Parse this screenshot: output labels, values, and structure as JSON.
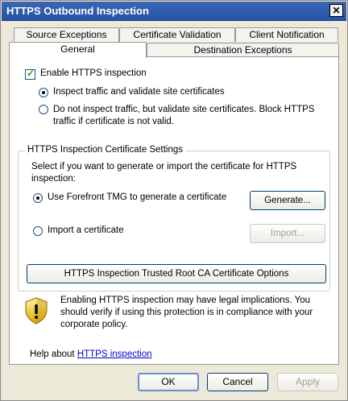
{
  "window": {
    "title": "HTTPS Outbound Inspection",
    "close_glyph": "✕"
  },
  "tabs": [
    {
      "label": "Source Exceptions"
    },
    {
      "label": "Certificate Validation"
    },
    {
      "label": "Client Notification"
    },
    {
      "label": "General"
    },
    {
      "label": "Destination Exceptions"
    }
  ],
  "general": {
    "enable_https_label": "Enable HTTPS inspection",
    "enable_https_checked": true,
    "radio_inspect_label": "Inspect traffic and validate site certificates",
    "radio_inspect_checked": true,
    "radio_noinspect_label_line1": "Do not inspect traffic, but validate site certificates. Block HTTPS",
    "radio_noinspect_label_line2": "traffic if certificate is not valid.",
    "radio_noinspect_checked": false
  },
  "cert_settings": {
    "group_title": "HTTPS Inspection Certificate Settings",
    "description_line1": "Select if you want to generate or import the certificate for HTTPS",
    "description_line2": "inspection:",
    "radio_generate_label": "Use Forefront TMG to generate a certificate",
    "radio_generate_checked": true,
    "generate_button": "Generate...",
    "radio_import_label": "Import a certificate",
    "radio_import_checked": false,
    "import_button": "Import...",
    "trusted_root_button": "HTTPS Inspection Trusted Root CA Certificate Options"
  },
  "warning": {
    "icon": "shield-warning-icon",
    "line1": "Enabling HTTPS inspection may have legal implications. You",
    "line2": "should verify if using this protection is in compliance with your",
    "line3": "corporate policy."
  },
  "help": {
    "prefix": "Help about",
    "link_text": "HTTPS inspection"
  },
  "footer": {
    "ok": "OK",
    "cancel": "Cancel",
    "apply": "Apply"
  }
}
